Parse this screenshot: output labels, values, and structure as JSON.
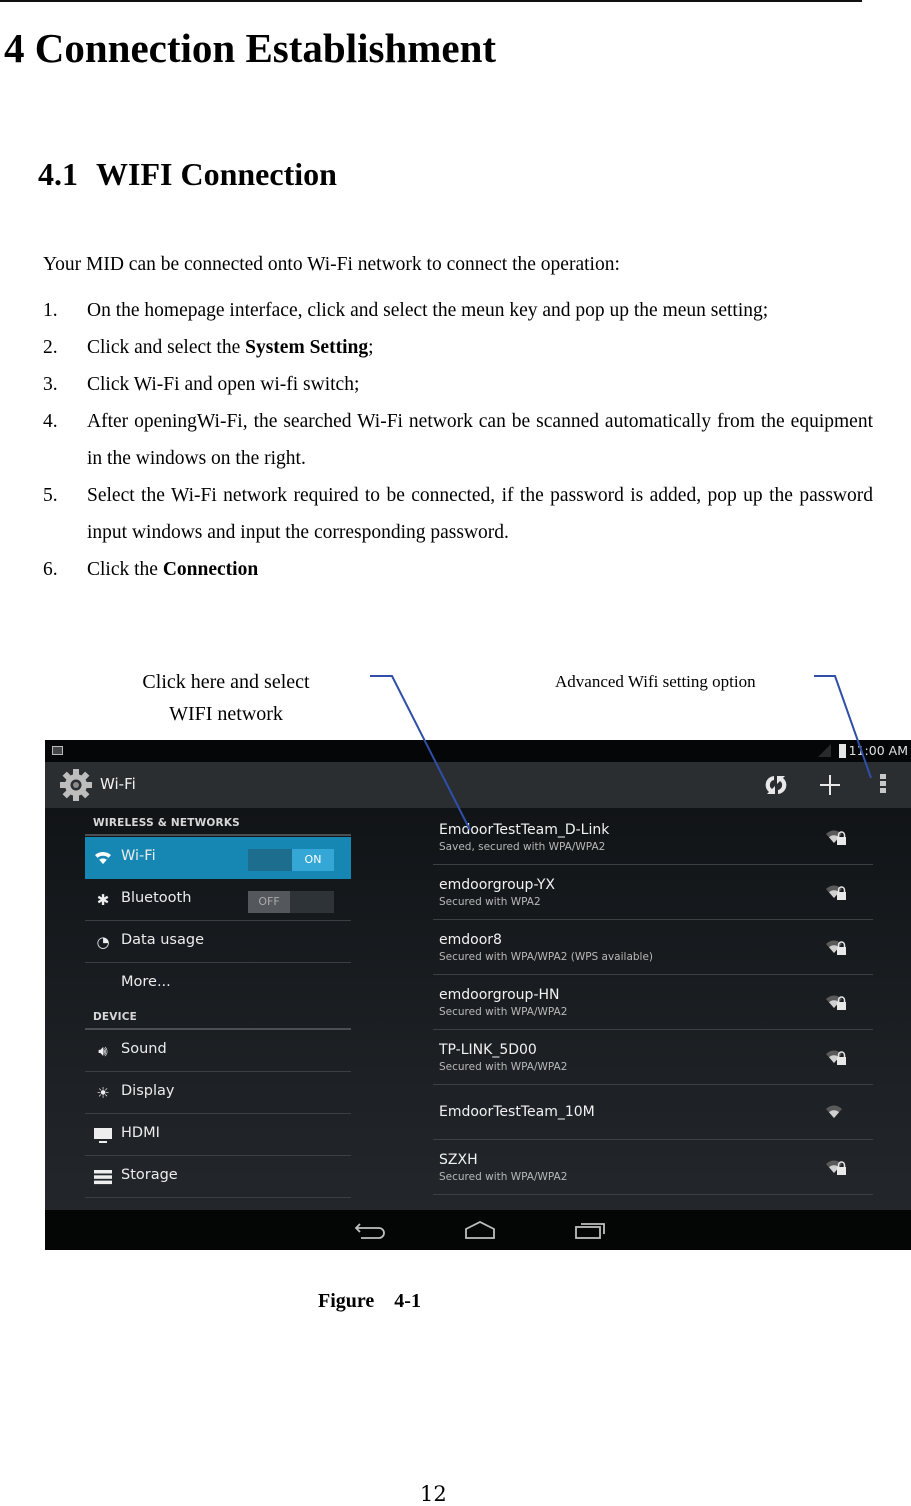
{
  "chapter": {
    "number": "4",
    "title": "Connection Establishment"
  },
  "section": {
    "number": "4.1",
    "title": "WIFI Connection"
  },
  "intro": "Your MID can be connected onto Wi-Fi network to connect the operation:",
  "steps": [
    {
      "num": "1.",
      "text": "On the homepage interface, click and select the meun key and pop up the meun setting;"
    },
    {
      "num": "2.",
      "pre": "Click and select the ",
      "bold": "System Setting",
      "post": ";"
    },
    {
      "num": "3.",
      "text": "Click Wi-Fi and open wi-fi switch;"
    },
    {
      "num": "4.",
      "text": "After openingWi-Fi, the searched Wi-Fi network can be scanned automatically from the equipment in the windows on the right."
    },
    {
      "num": "5.",
      "text": "Select the Wi-Fi network required to be connected, if the password is added, pop up the password input windows and input the corresponding password."
    },
    {
      "num": "6.",
      "pre": "Click the ",
      "bold": "Connection",
      "post": ""
    }
  ],
  "callouts": {
    "left_line1": "Click here and select",
    "left_line2": "WIFI network",
    "right": "Advanced Wifi setting option",
    "line_color": "#2f4fa8"
  },
  "screenshot": {
    "status_time": "11:00 AM",
    "app_title": "Wi-Fi",
    "actions": [
      "wps-refresh-icon",
      "add-network-icon",
      "overflow-menu-icon"
    ],
    "categories": [
      {
        "header": "WIRELESS & NETWORKS",
        "items": [
          {
            "icon": "wifi-icon",
            "label": "Wi-Fi",
            "toggle": "ON",
            "active": true
          },
          {
            "icon": "bluetooth-icon",
            "label": "Bluetooth",
            "toggle": "OFF"
          },
          {
            "icon": "data-usage-icon",
            "label": "Data usage"
          },
          {
            "icon": "",
            "label": "More..."
          }
        ]
      },
      {
        "header": "DEVICE",
        "items": [
          {
            "icon": "sound-icon",
            "label": "Sound"
          },
          {
            "icon": "display-icon",
            "label": "Display"
          },
          {
            "icon": "hdmi-icon",
            "label": "HDMI"
          },
          {
            "icon": "storage-icon",
            "label": "Storage"
          }
        ]
      }
    ],
    "networks": [
      {
        "name": "EmdoorTestTeam_D-Link",
        "status": "Saved, secured with WPA/WPA2",
        "secured": true
      },
      {
        "name": "emdoorgroup-YX",
        "status": "Secured with WPA2",
        "secured": true
      },
      {
        "name": "emdoor8",
        "status": "Secured with WPA/WPA2 (WPS available)",
        "secured": true
      },
      {
        "name": "emdoorgroup-HN",
        "status": "Secured with WPA/WPA2",
        "secured": true
      },
      {
        "name": "TP-LINK_5D00",
        "status": "Secured with WPA/WPA2",
        "secured": true
      },
      {
        "name": "EmdoorTestTeam_10M",
        "status": "",
        "secured": false
      },
      {
        "name": "SZXH",
        "status": "Secured with WPA/WPA2",
        "secured": true
      }
    ],
    "accent_color": "#1687b3"
  },
  "figure_caption": "Figure    4-1",
  "page_number": "12"
}
